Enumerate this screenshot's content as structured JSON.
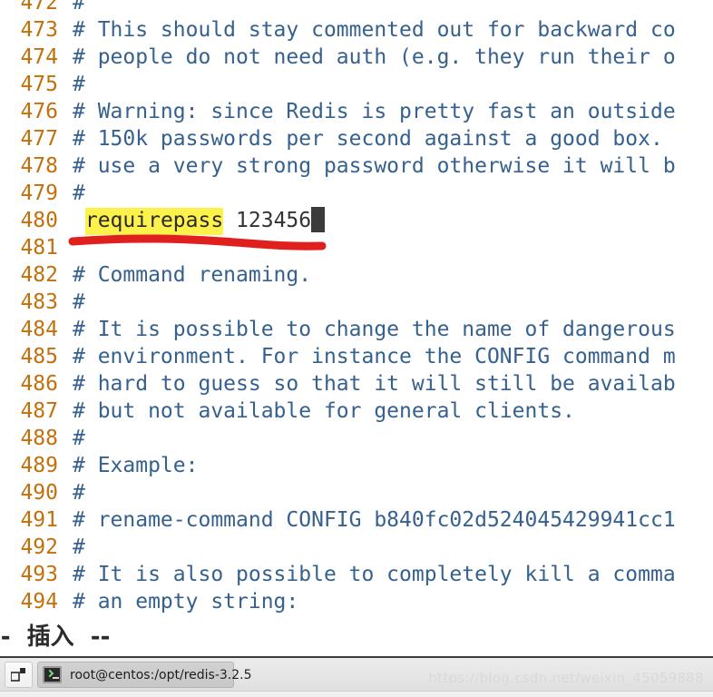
{
  "window": {
    "app": "vim",
    "mode_status": "--  插入  --"
  },
  "editor": {
    "font_color_lineno": "#c1700c",
    "font_color_comment": "#36618e",
    "highlight_color": "#fdf14c",
    "cursor_color": "#3b3b3b",
    "lines": [
      {
        "n": "472",
        "text": "#",
        "kind": "comment"
      },
      {
        "n": "473",
        "text": "# This should stay commented out for backward co",
        "kind": "comment"
      },
      {
        "n": "474",
        "text": "# people do not need auth (e.g. they run their o",
        "kind": "comment"
      },
      {
        "n": "475",
        "text": "#",
        "kind": "comment"
      },
      {
        "n": "476",
        "text": "# Warning: since Redis is pretty fast an outside",
        "kind": "comment"
      },
      {
        "n": "477",
        "text": "# 150k passwords per second against a good box.",
        "kind": "comment"
      },
      {
        "n": "478",
        "text": "# use a very strong password otherwise it will b",
        "kind": "comment"
      },
      {
        "n": "479",
        "text": "#",
        "kind": "comment"
      },
      {
        "n": "480",
        "text": " requirepass 123456",
        "kind": "active",
        "highlight": "requirepass",
        "value": "123456",
        "cursor": true
      },
      {
        "n": "481",
        "text": "",
        "kind": "comment"
      },
      {
        "n": "482",
        "text": "# Command renaming.",
        "kind": "comment"
      },
      {
        "n": "483",
        "text": "#",
        "kind": "comment"
      },
      {
        "n": "484",
        "text": "# It is possible to change the name of dangerous",
        "kind": "comment"
      },
      {
        "n": "485",
        "text": "# environment. For instance the CONFIG command m",
        "kind": "comment"
      },
      {
        "n": "486",
        "text": "# hard to guess so that it will still be availab",
        "kind": "comment"
      },
      {
        "n": "487",
        "text": "# but not available for general clients.",
        "kind": "comment"
      },
      {
        "n": "488",
        "text": "#",
        "kind": "comment"
      },
      {
        "n": "489",
        "text": "# Example:",
        "kind": "comment"
      },
      {
        "n": "490",
        "text": "#",
        "kind": "comment"
      },
      {
        "n": "491",
        "text": "# rename-command CONFIG b840fc02d524045429941cc1",
        "kind": "comment"
      },
      {
        "n": "492",
        "text": "#",
        "kind": "comment"
      },
      {
        "n": "493",
        "text": "# It is also possible to completely kill a comma",
        "kind": "comment"
      },
      {
        "n": "494",
        "text": "# an empty string:",
        "kind": "comment"
      }
    ]
  },
  "annotation": {
    "type": "red-underline",
    "color": "#e01f1f"
  },
  "taskbar": {
    "show_desktop_label": "show-desktop",
    "window_button_label": "root@centos:/opt/redis-3.2.5",
    "window_icon": "terminal-icon"
  },
  "watermark": {
    "text": "https://blog.csdn.net/weixin_45059888"
  }
}
